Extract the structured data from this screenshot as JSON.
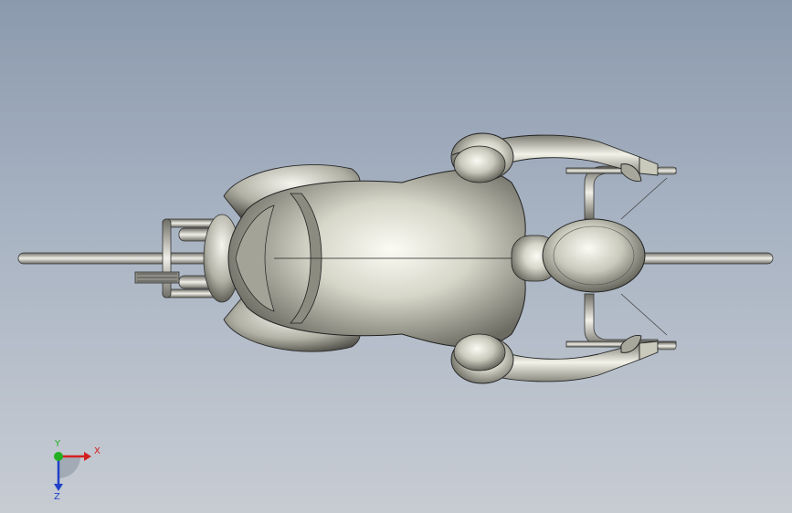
{
  "viewport": {
    "background_top": "#8c9aae",
    "background_bottom": "#c7ccd3"
  },
  "model": {
    "subject": "rider-on-motorcycle-top-view",
    "metal_light": "#f2f2ea",
    "metal_mid": "#b9b9ac",
    "metal_dark": "#5e5e55",
    "edge_color": "#222222"
  },
  "triad": {
    "x_label": "X",
    "y_label": "Y",
    "z_label": "Z",
    "x_color": "#d32020",
    "y_color": "#22b022",
    "z_color": "#2040c8"
  }
}
